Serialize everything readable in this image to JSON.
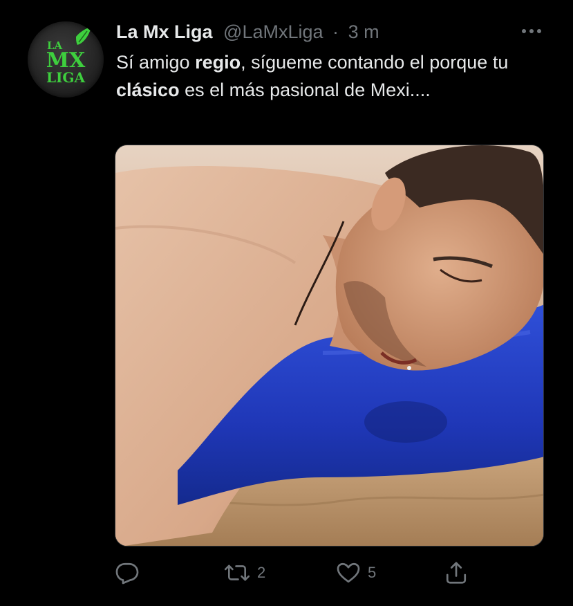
{
  "author": {
    "display_name": "La Mx Liga",
    "handle": "@LaMxLiga",
    "separator": "·",
    "timestamp": "3 m",
    "avatar_text": [
      "LA",
      "MX",
      "LIGA"
    ]
  },
  "tweet": {
    "segments": [
      {
        "text": "Sí amigo ",
        "bold": false
      },
      {
        "text": "regio",
        "bold": true
      },
      {
        "text": ", sígueme contando el porque tu ",
        "bold": false
      },
      {
        "text": "clásico",
        "bold": true
      },
      {
        "text": " es el más pasional de Mexi....",
        "bold": false
      }
    ],
    "image_description_icon": "photo"
  },
  "actions": {
    "reply_count": "",
    "retweet_count": "2",
    "like_count": "5"
  },
  "icons": {
    "more": "more-horizontal-icon",
    "reply": "reply-icon",
    "retweet": "retweet-icon",
    "like": "heart-icon",
    "share": "share-icon"
  },
  "colors": {
    "background": "#000000",
    "text_primary": "#e7e9ea",
    "text_secondary": "#71767b",
    "avatar_green": "#3ecf3e"
  }
}
